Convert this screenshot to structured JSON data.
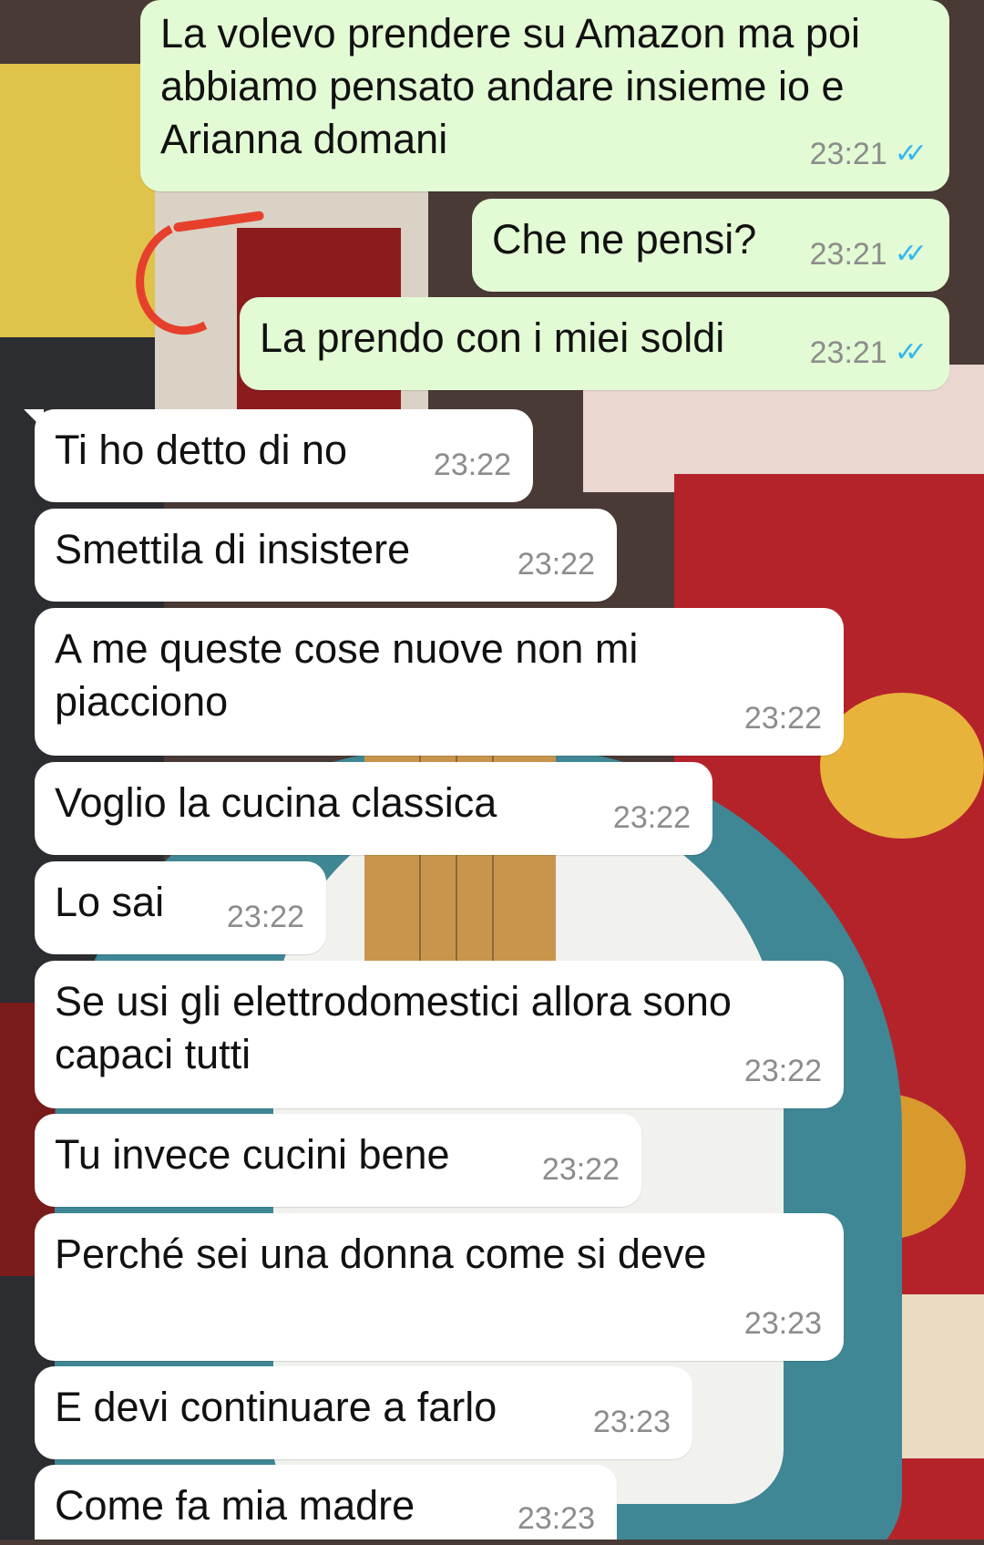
{
  "chat": {
    "messages": [
      {
        "direction": "out",
        "text": "La volevo prendere su Amazon ma poi abbiamo pensato andare insieme io e Arianna domani",
        "time": "23:21",
        "status": "read"
      },
      {
        "direction": "out",
        "text": "Che ne pensi?",
        "time": "23:21",
        "status": "read"
      },
      {
        "direction": "out",
        "text": "La prendo con i miei soldi",
        "time": "23:21",
        "status": "read"
      },
      {
        "direction": "in",
        "text": "Ti ho detto di no",
        "time": "23:22"
      },
      {
        "direction": "in",
        "text": "Smettila di insistere",
        "time": "23:22"
      },
      {
        "direction": "in",
        "text": "A me queste cose nuove non mi piacciono",
        "time": "23:22"
      },
      {
        "direction": "in",
        "text": "Voglio la cucina classica",
        "time": "23:22"
      },
      {
        "direction": "in",
        "text": "Lo sai",
        "time": "23:22"
      },
      {
        "direction": "in",
        "text": "Se usi gli elettrodomestici allora sono capaci tutti",
        "time": "23:22"
      },
      {
        "direction": "in",
        "text": "Tu invece cucini bene",
        "time": "23:22"
      },
      {
        "direction": "in",
        "text": "Perché sei una donna come si deve",
        "time": "23:23"
      },
      {
        "direction": "in",
        "text": "E devi continuare a farlo",
        "time": "23:23"
      },
      {
        "direction": "in",
        "text": "Come fa mia madre",
        "time": "23:23"
      }
    ],
    "read_receipt_icon": "double-check-icon",
    "colors": {
      "outgoing_bubble": "#e3fbd4",
      "incoming_bubble": "#ffffff",
      "timestamp": "#8c8c8c",
      "read_check": "#34b7f1",
      "annotation_mark": "#e6402d"
    }
  }
}
